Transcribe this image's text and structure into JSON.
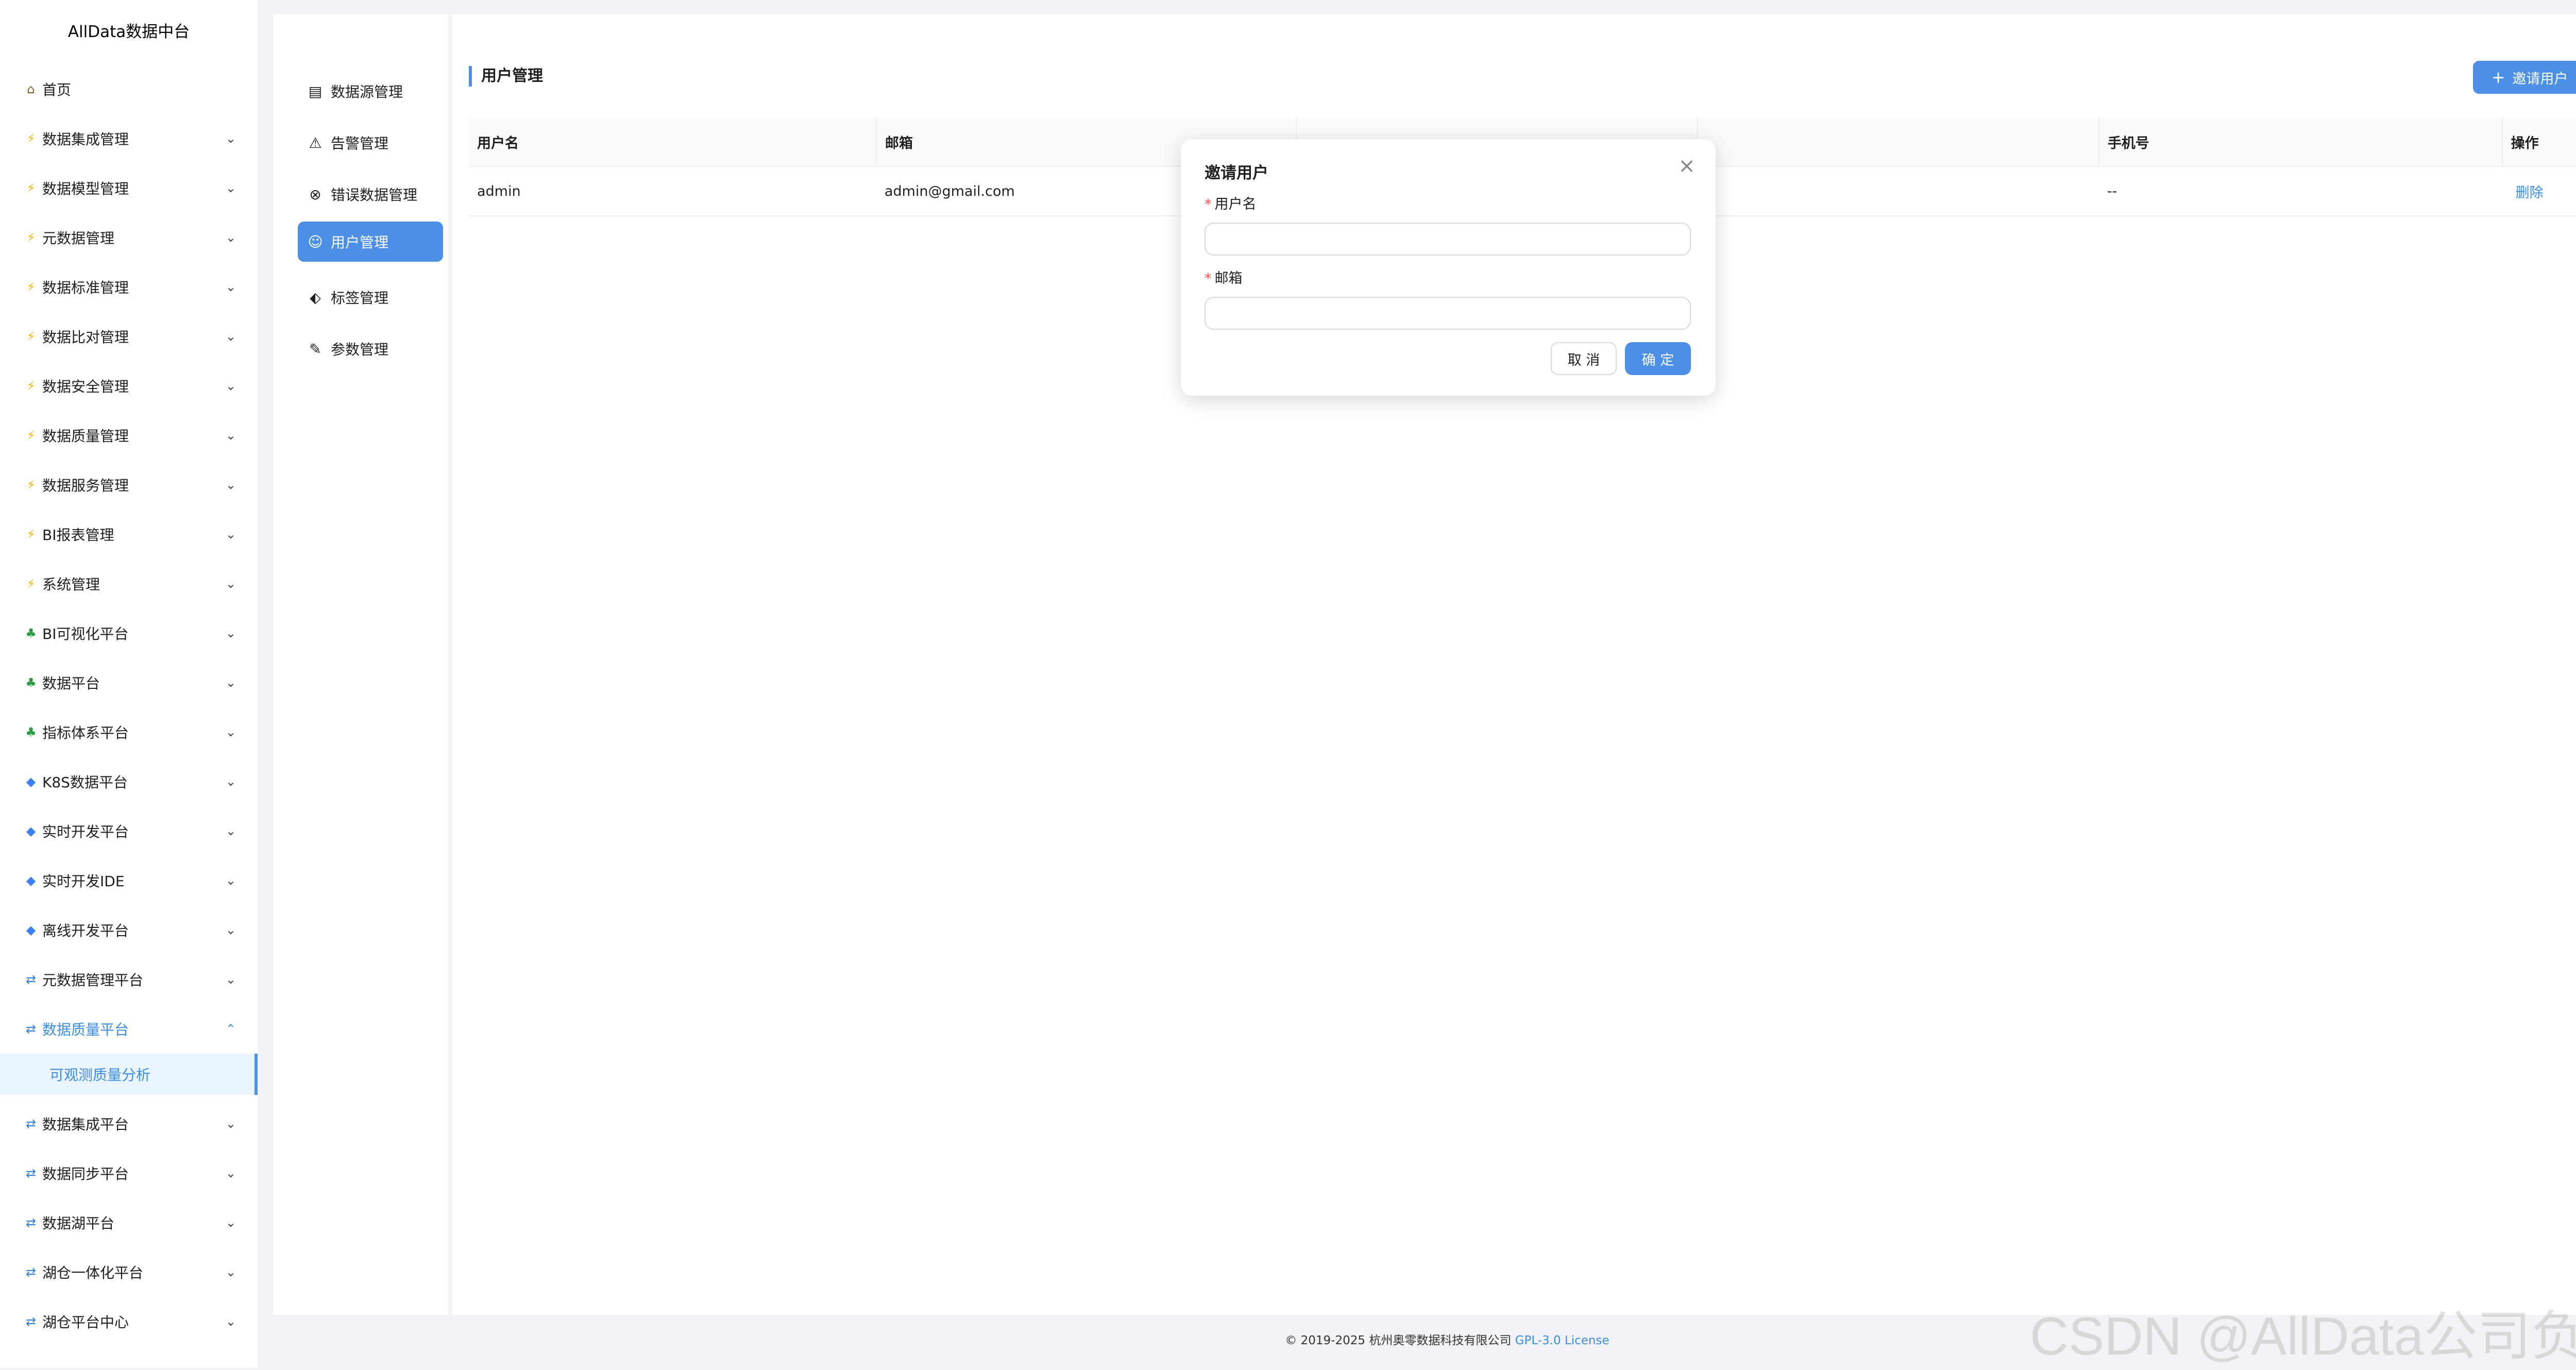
{
  "app": {
    "brand": "AllData数据中台"
  },
  "sidebar": {
    "items": [
      {
        "label": "首页",
        "icon": "house-icon",
        "has_chevron": false
      },
      {
        "label": "数据集成管理",
        "icon": "lightning-icon",
        "has_chevron": true
      },
      {
        "label": "数据模型管理",
        "icon": "lightning-icon",
        "has_chevron": true
      },
      {
        "label": "元数据管理",
        "icon": "lightning-icon",
        "has_chevron": true
      },
      {
        "label": "数据标准管理",
        "icon": "lightning-icon",
        "has_chevron": true
      },
      {
        "label": "数据比对管理",
        "icon": "lightning-icon",
        "has_chevron": true
      },
      {
        "label": "数据安全管理",
        "icon": "lightning-icon",
        "has_chevron": true
      },
      {
        "label": "数据质量管理",
        "icon": "lightning-icon",
        "has_chevron": true
      },
      {
        "label": "数据服务管理",
        "icon": "lightning-icon",
        "has_chevron": true
      },
      {
        "label": "BI报表管理",
        "icon": "lightning-icon",
        "has_chevron": true
      },
      {
        "label": "系统管理",
        "icon": "lightning-icon",
        "has_chevron": true
      },
      {
        "label": "BI可视化平台",
        "icon": "palm-tree-icon",
        "has_chevron": true
      },
      {
        "label": "数据平台",
        "icon": "palm-tree-icon",
        "has_chevron": true
      },
      {
        "label": "指标体系平台",
        "icon": "palm-tree-icon",
        "has_chevron": true
      },
      {
        "label": "K8S数据平台",
        "icon": "gem-icon",
        "has_chevron": true
      },
      {
        "label": "实时开发平台",
        "icon": "gem-icon",
        "has_chevron": true
      },
      {
        "label": "实时开发IDE",
        "icon": "gem-icon",
        "has_chevron": true
      },
      {
        "label": "离线开发平台",
        "icon": "gem-icon",
        "has_chevron": true
      },
      {
        "label": "元数据管理平台",
        "icon": "sync-icon",
        "has_chevron": true
      },
      {
        "label": "数据质量平台",
        "icon": "sync-icon",
        "has_chevron": true,
        "open": true,
        "children": [
          {
            "label": "可观测质量分析",
            "active": true
          }
        ]
      },
      {
        "label": "数据集成平台",
        "icon": "sync-icon",
        "has_chevron": true
      },
      {
        "label": "数据同步平台",
        "icon": "sync-icon",
        "has_chevron": true
      },
      {
        "label": "数据湖平台",
        "icon": "sync-icon",
        "has_chevron": true
      },
      {
        "label": "湖仓一体化平台",
        "icon": "sync-icon",
        "has_chevron": true
      },
      {
        "label": "湖仓平台中心",
        "icon": "sync-icon",
        "has_chevron": true
      }
    ]
  },
  "submenu": {
    "items": [
      {
        "label": "数据源管理",
        "icon": "database-icon"
      },
      {
        "label": "告警管理",
        "icon": "warning-triangle-icon"
      },
      {
        "label": "错误数据管理",
        "icon": "circle-x-icon"
      },
      {
        "label": "用户管理",
        "icon": "users-icon",
        "active": true
      },
      {
        "label": "标签管理",
        "icon": "tag-icon"
      },
      {
        "label": "参数管理",
        "icon": "edit-icon"
      }
    ]
  },
  "page": {
    "title": "用户管理",
    "invite_button": "邀请用户",
    "table": {
      "columns": [
        "用户名",
        "邮箱",
        "",
        "",
        "手机号",
        "操作"
      ],
      "rows": [
        {
          "username": "admin",
          "email": "admin@gmail.com",
          "phone": "--",
          "action": "删除"
        }
      ]
    }
  },
  "modal": {
    "title": "邀请用户",
    "username_label": "用户名",
    "email_label": "邮箱",
    "username_value": "",
    "email_value": "",
    "cancel": "取 消",
    "ok": "确 定"
  },
  "footer": {
    "copyright": "© 2019-2025 杭州奥零数据科技有限公司",
    "license": "GPL-3.0 License"
  },
  "watermark": "CSDN @AllData公司负责人",
  "colors": {
    "accent": "#4b8fe6",
    "link": "#3a8ee6",
    "required": "#ff4d4f"
  }
}
